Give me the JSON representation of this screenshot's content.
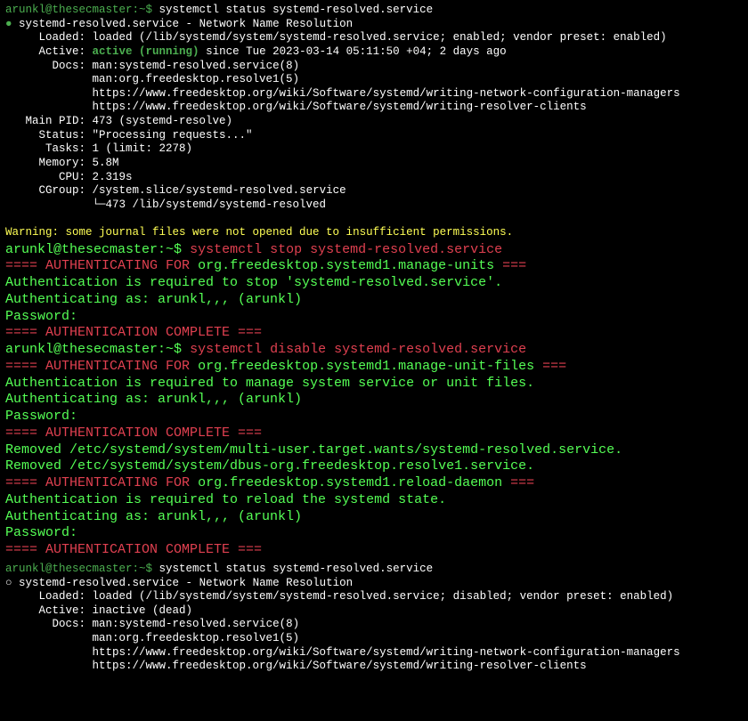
{
  "s1": {
    "prompt": "arunkl@thesecmaster:~$",
    "cmd": "systemctl status systemd-resolved.service",
    "bullet": "●",
    "title": "systemd-resolved.service - Network Name Resolution",
    "loaded_lbl": "     Loaded:",
    "loaded": "loaded (/lib/systemd/system/systemd-resolved.service; enabled; vendor preset: enabled)",
    "active_lbl": "     Active:",
    "active_val": "active (running)",
    "active_since": "since Tue 2023-03-14 05:11:50 +04; 2 days ago",
    "docs_lbl": "       Docs:",
    "doc1": "man:systemd-resolved.service(8)",
    "doc2": "             man:org.freedesktop.resolve1(5)",
    "doc3": "             https://www.freedesktop.org/wiki/Software/systemd/writing-network-configuration-managers",
    "doc4": "             https://www.freedesktop.org/wiki/Software/systemd/writing-resolver-clients",
    "pid_lbl": "   Main PID:",
    "pid": "473 (systemd-resolve)",
    "status_lbl": "     Status:",
    "status": "\"Processing requests...\"",
    "tasks_lbl": "      Tasks:",
    "tasks": "1 (limit: 2278)",
    "mem_lbl": "     Memory:",
    "mem": "5.8M",
    "cpu_lbl": "        CPU:",
    "cpu": "2.319s",
    "cgroup_lbl": "     CGroup:",
    "cgroup": "/system.slice/systemd-resolved.service",
    "cgroup2": "             └─473 /lib/systemd/systemd-resolved",
    "warn": "Warning: some journal files were not opened due to insufficient permissions."
  },
  "s2": {
    "prompt": "arunkl@thesecmaster:~$",
    "cmd": "systemctl stop systemd-resolved.service",
    "auth_for": "==== AUTHENTICATING FOR",
    "auth_unit": "org.freedesktop.systemd1.manage-units",
    "auth_end": "===",
    "msg": "Authentication is required to stop 'systemd-resolved.service'.",
    "auth_as": "Authenticating as: arunkl,,, (arunkl)",
    "password": "Password:",
    "complete": "==== AUTHENTICATION COMPLETE ==="
  },
  "s3": {
    "prompt": "arunkl@thesecmaster:~$",
    "cmd": "systemctl disable systemd-resolved.service",
    "auth_for": "==== AUTHENTICATING FOR",
    "unit1": "org.freedesktop.systemd1.manage-unit-files",
    "end": "===",
    "msg1": "Authentication is required to manage system service or unit files.",
    "auth_as": "Authenticating as: arunkl,,, (arunkl)",
    "password": "Password:",
    "complete": "==== AUTHENTICATION COMPLETE ===",
    "removed1": "Removed /etc/systemd/system/multi-user.target.wants/systemd-resolved.service.",
    "removed2": "Removed /etc/systemd/system/dbus-org.freedesktop.resolve1.service.",
    "unit2": "org.freedesktop.systemd1.reload-daemon",
    "msg2": "Authentication is required to reload the systemd state."
  },
  "s4": {
    "prompt": "arunkl@thesecmaster:~$",
    "cmd": "systemctl status systemd-resolved.service",
    "bullet": "○",
    "title": "systemd-resolved.service - Network Name Resolution",
    "loaded_lbl": "     Loaded:",
    "loaded": "loaded (/lib/systemd/system/systemd-resolved.service; disabled; vendor preset: enabled)",
    "active_lbl": "     Active:",
    "active": "inactive (dead)",
    "docs_lbl": "       Docs:",
    "doc1": "man:systemd-resolved.service(8)",
    "doc2": "             man:org.freedesktop.resolve1(5)",
    "doc3": "             https://www.freedesktop.org/wiki/Software/systemd/writing-network-configuration-managers",
    "doc4": "             https://www.freedesktop.org/wiki/Software/systemd/writing-resolver-clients"
  }
}
